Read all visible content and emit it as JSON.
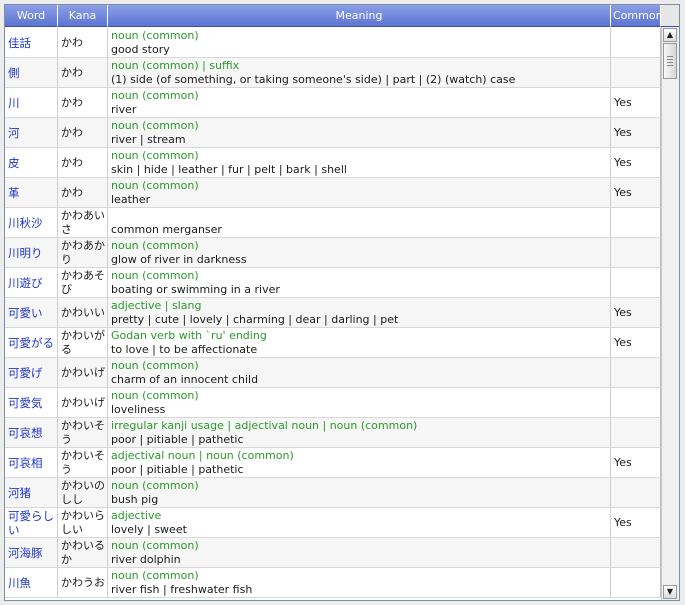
{
  "columns": {
    "word": "Word",
    "kana": "Kana",
    "meaning": "Meaning",
    "common": "Common"
  },
  "scroll": {
    "up_icon": "triangle-up-icon",
    "down_icon": "triangle-down-icon",
    "up_glyph": "▲",
    "down_glyph": "▼"
  },
  "rows": [
    {
      "word": "佳話",
      "kana": "かわ",
      "tags": "noun (common)",
      "gloss": "good story",
      "common": ""
    },
    {
      "word": "側",
      "kana": "かわ",
      "tags": "noun (common) | suffix",
      "gloss": "(1) side (of something, or taking someone's side) | part | (2) (watch) case",
      "common": ""
    },
    {
      "word": "川",
      "kana": "かわ",
      "tags": "noun (common)",
      "gloss": "river",
      "common": "Yes"
    },
    {
      "word": "河",
      "kana": "かわ",
      "tags": "noun (common)",
      "gloss": "river | stream",
      "common": "Yes"
    },
    {
      "word": "皮",
      "kana": "かわ",
      "tags": "noun (common)",
      "gloss": "skin | hide | leather | fur | pelt | bark | shell",
      "common": "Yes"
    },
    {
      "word": "革",
      "kana": "かわ",
      "tags": "noun (common)",
      "gloss": "leather",
      "common": "Yes"
    },
    {
      "word": "川秋沙",
      "kana": "かわあいさ",
      "tags": "",
      "gloss": "common merganser",
      "common": ""
    },
    {
      "word": "川明り",
      "kana": "かわあかり",
      "tags": "noun (common)",
      "gloss": "glow of river in darkness",
      "common": ""
    },
    {
      "word": "川遊び",
      "kana": "かわあそび",
      "tags": "noun (common)",
      "gloss": "boating or swimming in a river",
      "common": ""
    },
    {
      "word": "可愛い",
      "kana": "かわいい",
      "tags": "adjective | slang",
      "gloss": "pretty | cute | lovely | charming | dear | darling | pet",
      "common": "Yes"
    },
    {
      "word": "可愛がる",
      "kana": "かわいがる",
      "tags": "Godan verb with `ru' ending",
      "gloss": "to love | to be affectionate",
      "common": "Yes"
    },
    {
      "word": "可愛げ",
      "kana": "かわいげ",
      "tags": "noun (common)",
      "gloss": "charm of an innocent child",
      "common": ""
    },
    {
      "word": "可愛気",
      "kana": "かわいげ",
      "tags": "noun (common)",
      "gloss": "loveliness",
      "common": ""
    },
    {
      "word": "可哀想",
      "kana": "かわいそう",
      "tags": "irregular kanji usage | adjectival noun | noun (common)",
      "gloss": "poor | pitiable | pathetic",
      "common": ""
    },
    {
      "word": "可哀相",
      "kana": "かわいそう",
      "tags": "adjectival noun | noun (common)",
      "gloss": "poor | pitiable | pathetic",
      "common": "Yes"
    },
    {
      "word": "河猪",
      "kana": "かわいのしし",
      "tags": "noun (common)",
      "gloss": "bush pig",
      "common": ""
    },
    {
      "word": "可愛らしい",
      "kana": "かわいらしい",
      "tags": "adjective",
      "gloss": "lovely | sweet",
      "common": "Yes"
    },
    {
      "word": "河海豚",
      "kana": "かわいるか",
      "tags": "noun (common)",
      "gloss": "river dolphin",
      "common": ""
    },
    {
      "word": "川魚",
      "kana": "かわうお",
      "tags": "noun (common)",
      "gloss": "river fish | freshwater fish",
      "common": ""
    }
  ]
}
